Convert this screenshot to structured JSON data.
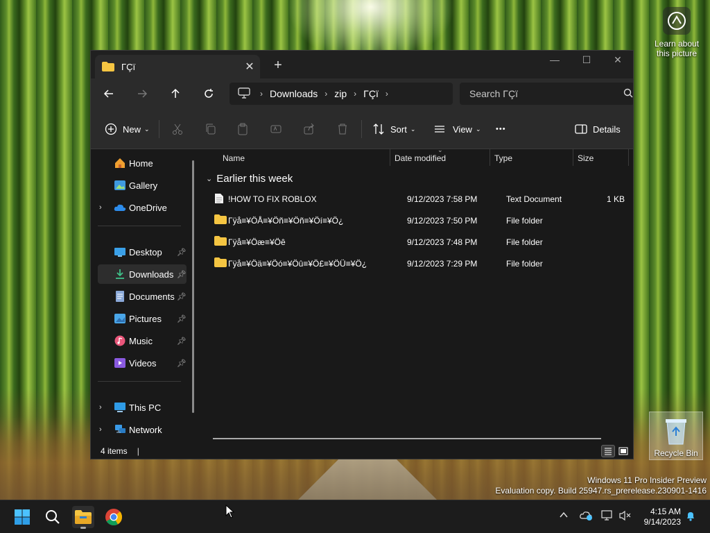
{
  "desktop": {
    "learn_label": "Learn about this picture",
    "recycle_label": "Recycle Bin",
    "watermark_line1": "Windows 11 Pro Insider Preview",
    "watermark_line2": "Evaluation copy. Build 25947.rs_prerelease.230901-1416"
  },
  "window": {
    "tab_title": "ΓÇï",
    "tab_close": "✕",
    "new_tab": "+",
    "minimize": "—",
    "maximize": "☐",
    "close": "✕"
  },
  "address": {
    "crumbs": [
      "Downloads",
      "zip",
      "ΓÇï"
    ],
    "search_placeholder": "Search ΓÇï"
  },
  "toolbar": {
    "new_label": "New",
    "sort_label": "Sort",
    "view_label": "View",
    "more_label": "•••",
    "details_label": "Details"
  },
  "sidebar": {
    "items": [
      {
        "label": "Home",
        "icon": "home-icon"
      },
      {
        "label": "Gallery",
        "icon": "gallery-icon"
      },
      {
        "label": "OneDrive",
        "icon": "cloud-icon"
      },
      {
        "label": "Desktop",
        "icon": "desktop-icon"
      },
      {
        "label": "Downloads",
        "icon": "download-icon"
      },
      {
        "label": "Documents",
        "icon": "document-icon"
      },
      {
        "label": "Pictures",
        "icon": "picture-icon"
      },
      {
        "label": "Music",
        "icon": "music-icon"
      },
      {
        "label": "Videos",
        "icon": "video-icon"
      },
      {
        "label": "This PC",
        "icon": "computer-icon"
      },
      {
        "label": "Network",
        "icon": "network-icon"
      }
    ],
    "selected": "Downloads"
  },
  "files": {
    "columns": [
      "Name",
      "Date modified",
      "Type",
      "Size"
    ],
    "group": "Earlier this week",
    "rows": [
      {
        "name": "!HOW TO FIX ROBLOX",
        "date": "9/12/2023 7:58 PM",
        "type": "Text Document",
        "size": "1 KB",
        "icon": "text-file-icon"
      },
      {
        "name": "Γÿå≡¥ÖÅ≡¥Öñ≡¥Öñ≡¥Öí≡¥Ö¿",
        "date": "9/12/2023 7:50 PM",
        "type": "File folder",
        "size": "",
        "icon": "folder-icon"
      },
      {
        "name": "Γÿå≡¥Öæ≡¥Öê",
        "date": "9/12/2023 7:48 PM",
        "type": "File folder",
        "size": "",
        "icon": "folder-icon"
      },
      {
        "name": "Γÿå≡¥Öä≡¥Öó≡¥Öû≡¥Ö£≡¥ÖÜ≡¥Ö¿",
        "date": "9/12/2023 7:29 PM",
        "type": "File folder",
        "size": "",
        "icon": "folder-icon"
      }
    ]
  },
  "status": {
    "items_count": "4 items",
    "caret": "|"
  },
  "taskbar": {
    "time": "4:15 AM",
    "date": "9/14/2023"
  },
  "colors": {
    "accent": "#4cc2ff",
    "folder": "#f5c542",
    "window_bg": "#191919",
    "toolbar_bg": "#2b2b2b"
  }
}
